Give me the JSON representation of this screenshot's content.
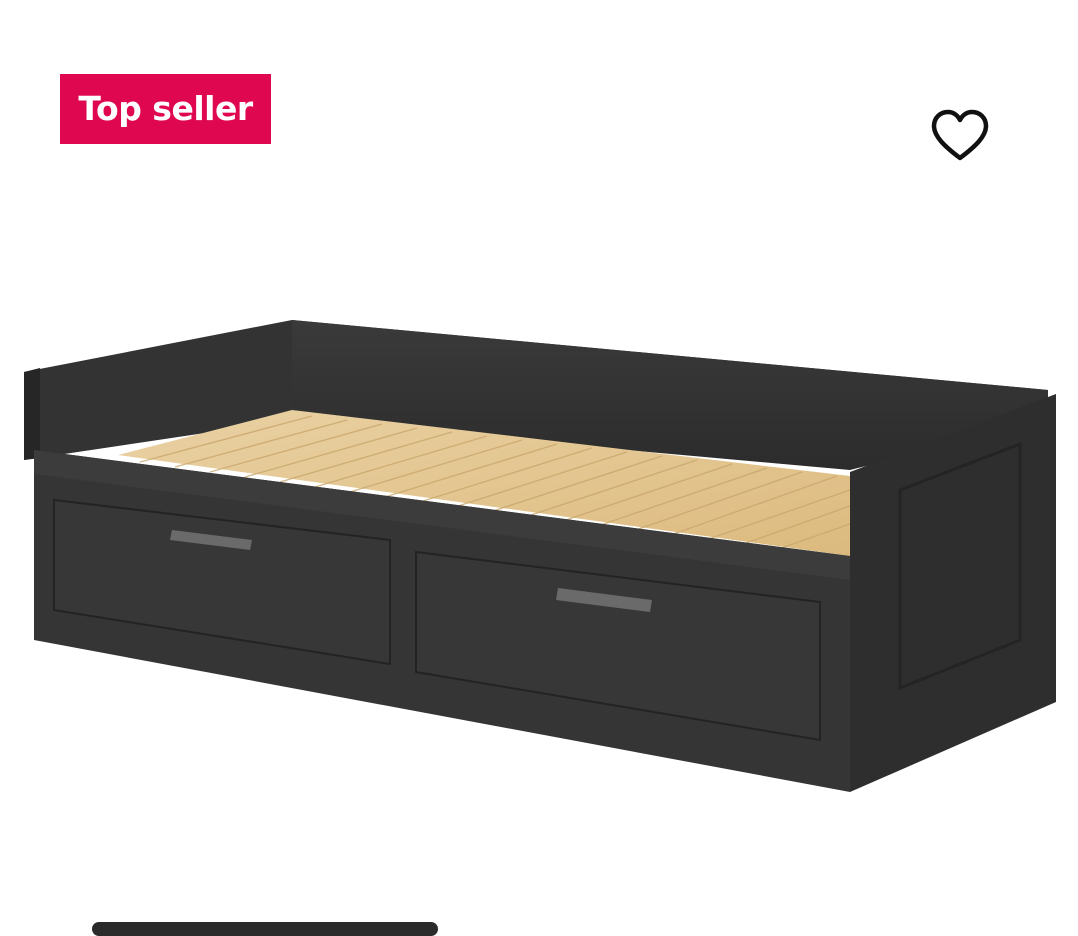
{
  "badge": {
    "label": "Top seller",
    "color": "#e00751"
  },
  "favorite": {
    "icon": "heart-outline-icon"
  },
  "product": {
    "image": "black-daybed-with-two-drawers",
    "frame_color": "#2f2f2f",
    "slat_color": "#e3c691"
  }
}
